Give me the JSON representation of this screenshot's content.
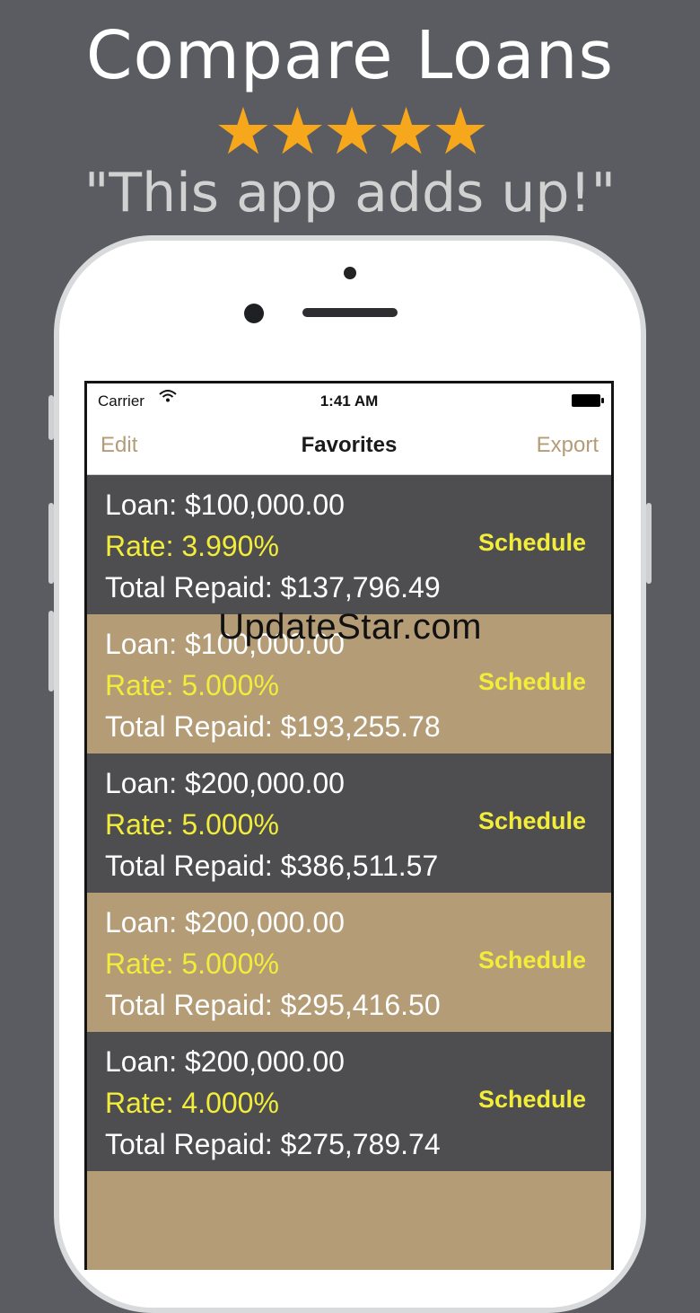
{
  "promo": {
    "headline": "Compare Loans",
    "stars": "★★★★★",
    "quote": "\"This app adds up!\""
  },
  "statusbar": {
    "carrier": "Carrier",
    "time": "1:41 AM"
  },
  "navbar": {
    "left": "Edit",
    "title": "Favorites",
    "right": "Export"
  },
  "loans": [
    {
      "loan": "Loan: $100,000.00",
      "rate": "Rate: 3.990%",
      "total": "Total Repaid: $137,796.49",
      "action": "Schedule"
    },
    {
      "loan": "Loan: $100,000.00",
      "rate": "Rate: 5.000%",
      "total": "Total Repaid: $193,255.78",
      "action": "Schedule"
    },
    {
      "loan": "Loan: $200,000.00",
      "rate": "Rate: 5.000%",
      "total": "Total Repaid: $386,511.57",
      "action": "Schedule"
    },
    {
      "loan": "Loan: $200,000.00",
      "rate": "Rate: 5.000%",
      "total": "Total Repaid: $295,416.50",
      "action": "Schedule"
    },
    {
      "loan": "Loan: $200,000.00",
      "rate": "Rate: 4.000%",
      "total": "Total Repaid: $275,789.74",
      "action": "Schedule"
    }
  ],
  "watermark": "UpdateStar.com",
  "colors": {
    "background": "#5b5c61",
    "star": "#f6a71c",
    "row_dark": "#4e4e50",
    "row_tan": "#b49c76",
    "rate_text": "#f2ec3a"
  }
}
